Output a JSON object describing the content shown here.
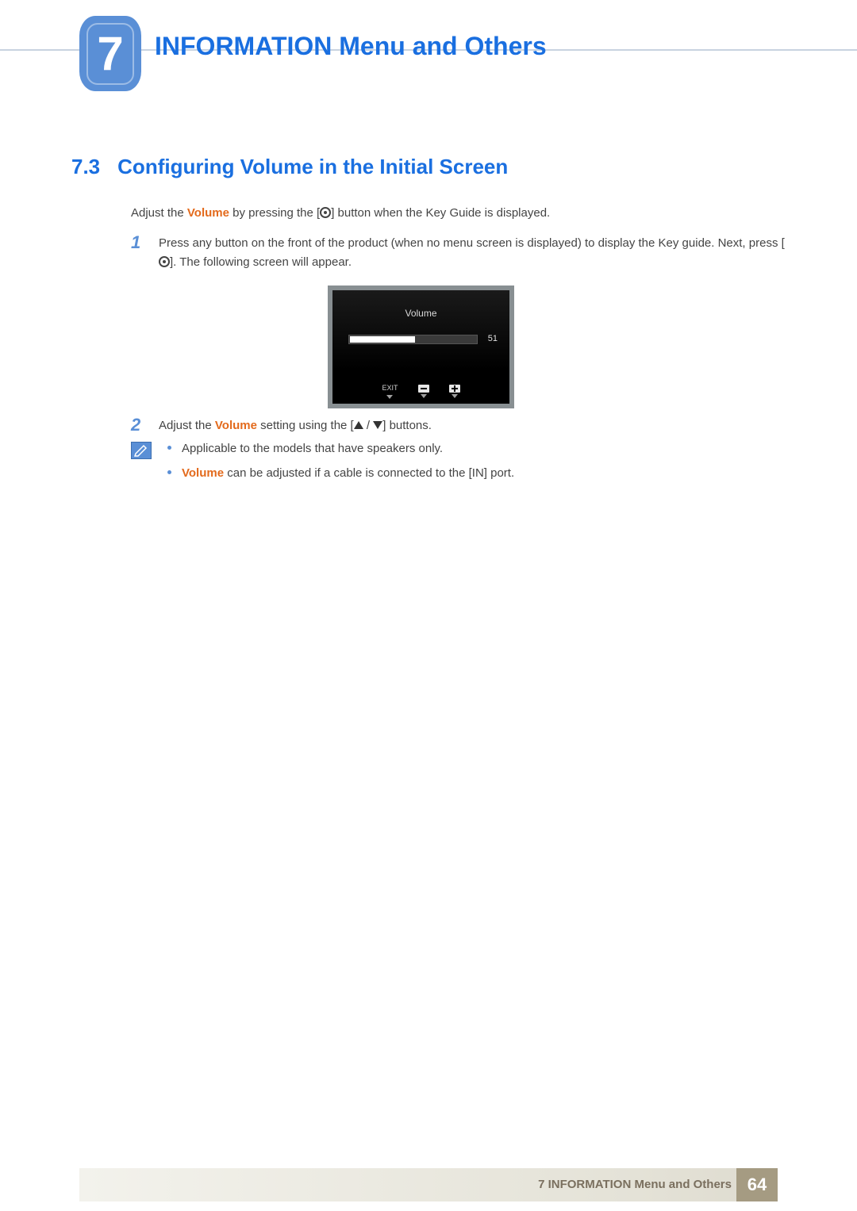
{
  "chapter": {
    "number": "7",
    "title": "INFORMATION Menu and Others"
  },
  "section": {
    "number": "7.3",
    "title": "Configuring Volume in the Initial Screen"
  },
  "intro": {
    "pre": "Adjust the ",
    "volume_word": "Volume",
    "post": " by pressing the [",
    "post2": "] button when the Key Guide is displayed."
  },
  "steps": {
    "s1_num": "1",
    "s1_a": "Press any button on the front of the product (when no menu screen is displayed) to display the Key guide. Next, press [",
    "s1_b": "]. The following screen will appear.",
    "s2_num": "2",
    "s2_a": "Adjust the ",
    "s2_vol": "Volume",
    "s2_b": " setting using the [",
    "s2_c": "] buttons."
  },
  "osd": {
    "title": "Volume",
    "value": "51",
    "exit": "EXIT"
  },
  "notes": {
    "n1": "Applicable to the models that have speakers only.",
    "n2_vol": "Volume",
    "n2_rest": " can be adjusted if a cable is connected to the [IN] port."
  },
  "footer": {
    "text": "7 INFORMATION Menu and Others",
    "page": "64"
  }
}
